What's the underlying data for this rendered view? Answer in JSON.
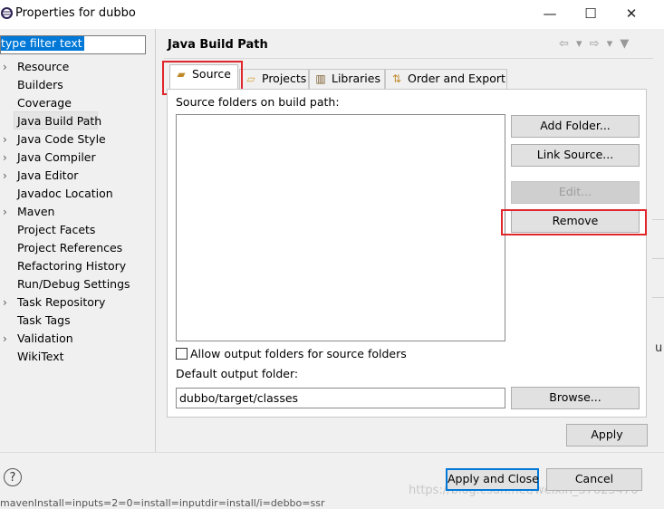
{
  "window": {
    "title": "Properties for dubbo",
    "minimize_glyph": "—",
    "maximize_glyph": "☐",
    "close_glyph": "✕"
  },
  "filter": {
    "value": "type filter text"
  },
  "tree": {
    "items": [
      {
        "label": "Resource",
        "expandable": true
      },
      {
        "label": "Builders",
        "expandable": false
      },
      {
        "label": "Coverage",
        "expandable": false
      },
      {
        "label": "Java Build Path",
        "expandable": false,
        "selected": true
      },
      {
        "label": "Java Code Style",
        "expandable": true
      },
      {
        "label": "Java Compiler",
        "expandable": true
      },
      {
        "label": "Java Editor",
        "expandable": true
      },
      {
        "label": "Javadoc Location",
        "expandable": false
      },
      {
        "label": "Maven",
        "expandable": true
      },
      {
        "label": "Project Facets",
        "expandable": false
      },
      {
        "label": "Project References",
        "expandable": false
      },
      {
        "label": "Refactoring History",
        "expandable": false
      },
      {
        "label": "Run/Debug Settings",
        "expandable": false
      },
      {
        "label": "Task Repository",
        "expandable": true
      },
      {
        "label": "Task Tags",
        "expandable": false
      },
      {
        "label": "Validation",
        "expandable": true
      },
      {
        "label": "WikiText",
        "expandable": false
      }
    ]
  },
  "page": {
    "title": "Java Build Path",
    "nav": "⇦ ▾ ⇨ ▾ ▼"
  },
  "tabs": [
    {
      "label": "Source",
      "icon": "source-folder-icon",
      "active": true
    },
    {
      "label": "Projects",
      "icon": "projects-icon"
    },
    {
      "label": "Libraries",
      "icon": "libraries-icon"
    },
    {
      "label": "Order and Export",
      "icon": "order-export-icon"
    }
  ],
  "source": {
    "folders_label": "Source folders on build path:",
    "buttons": {
      "add_folder": "Add Folder...",
      "link_source": "Link Source...",
      "edit": "Edit...",
      "remove": "Remove"
    },
    "allow_output_label": "Allow output folders for source folders",
    "default_output_label": "Default output folder:",
    "default_output_value": "dubbo/target/classes",
    "browse": "Browse..."
  },
  "apply": "Apply",
  "footer": {
    "help": "?",
    "apply_close": "Apply and Close",
    "cancel": "Cancel"
  },
  "background": {
    "bottom_text": "mavenInstall=inputs=2=0=install=inputdir=install/i=debbo=ssr",
    "watermark": "https://blog.csdn.net/weixin_37623470",
    "right_edge": "u"
  },
  "colors": {
    "highlight": "#e0252b",
    "selection": "#0078d7"
  }
}
